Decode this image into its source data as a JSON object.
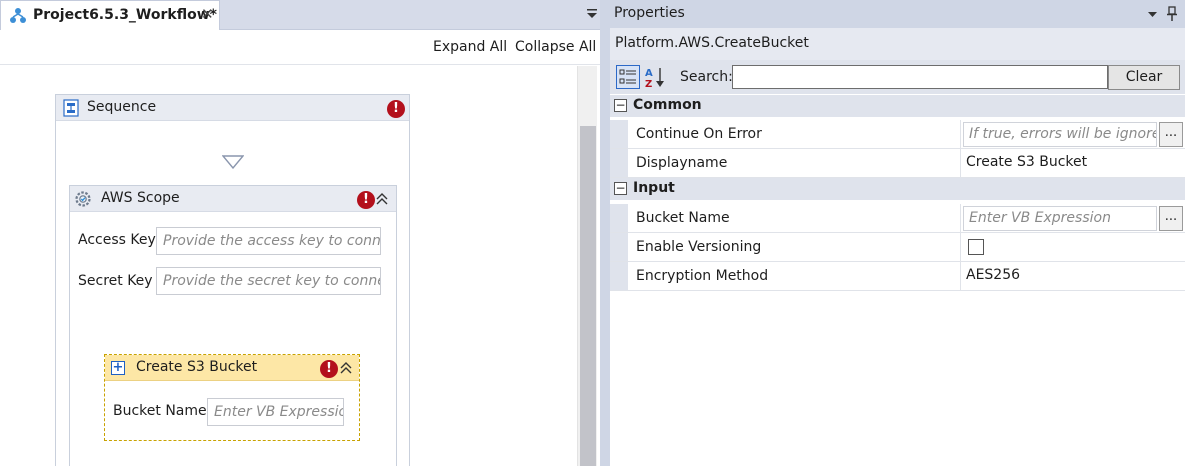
{
  "tab": {
    "title": "Project6.5.3_Workflow*",
    "close_glyph": "✕",
    "icon": "workflow-icon"
  },
  "toolbar": {
    "expand_all": "Expand All",
    "collapse_all": "Collapse All"
  },
  "designer": {
    "sequence": {
      "title": "Sequence",
      "has_error": true
    },
    "aws_scope": {
      "title": "AWS Scope",
      "has_error": true,
      "fields": [
        {
          "label": "Access Key",
          "placeholder": "Provide the access key to connect"
        },
        {
          "label": "Secret Key",
          "placeholder": "Provide the secret key to connect"
        }
      ]
    },
    "create_bucket": {
      "title": "Create S3 Bucket",
      "has_error": true,
      "field": {
        "label": "Bucket Name",
        "placeholder": "Enter VB Expression"
      }
    },
    "error_glyph": "!",
    "collapse_glyph": "⌃"
  },
  "properties": {
    "panel_title": "Properties",
    "object_type": "Platform.AWS.CreateBucket",
    "search_label": "Search:",
    "search_value": "",
    "clear_label": "Clear",
    "ellipsis": "...",
    "categories": [
      {
        "name": "Common",
        "toggle": "−",
        "rows": [
          {
            "name": "Continue On Error",
            "placeholder": "If true, errors will be ignored"
          },
          {
            "name": "Displayname",
            "value": "Create S3 Bucket"
          }
        ]
      },
      {
        "name": "Input",
        "toggle": "−",
        "rows": [
          {
            "name": "Bucket Name",
            "placeholder": "Enter VB Expression"
          },
          {
            "name": "Enable Versioning",
            "checked": false
          },
          {
            "name": "Encryption Method",
            "value": "AES256"
          }
        ]
      }
    ]
  },
  "colors": {
    "error": "#b3101c",
    "selected_header": "#fde7a6",
    "accent": "#2c69c7"
  }
}
